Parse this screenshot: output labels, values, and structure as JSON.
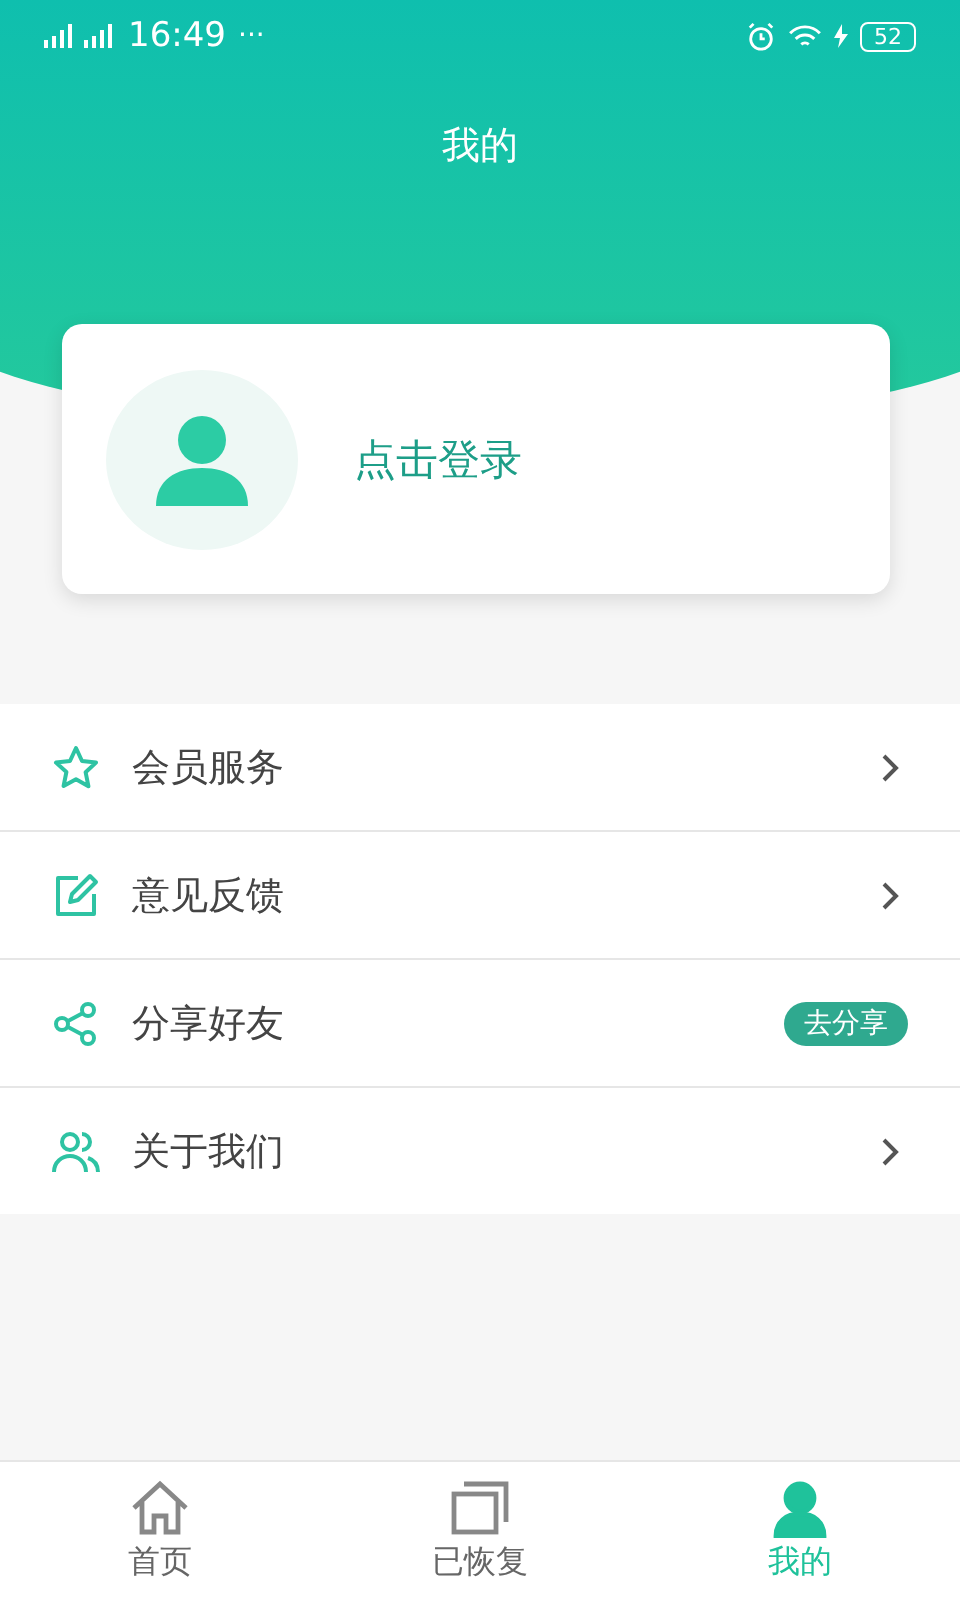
{
  "status_bar": {
    "time": "16:49",
    "more": "···",
    "battery": "52"
  },
  "header": {
    "title": "我的"
  },
  "profile": {
    "login_label": "点击登录"
  },
  "menu": [
    {
      "label": "会员服务",
      "kind": "arrow"
    },
    {
      "label": "意见反馈",
      "kind": "arrow"
    },
    {
      "label": "分享好友",
      "kind": "badge",
      "badge": "去分享"
    },
    {
      "label": "关于我们",
      "kind": "arrow"
    }
  ],
  "tab_bar": [
    {
      "label": "首页",
      "selected": false
    },
    {
      "label": "已恢复",
      "selected": false
    },
    {
      "label": "我的",
      "selected": true
    }
  ]
}
